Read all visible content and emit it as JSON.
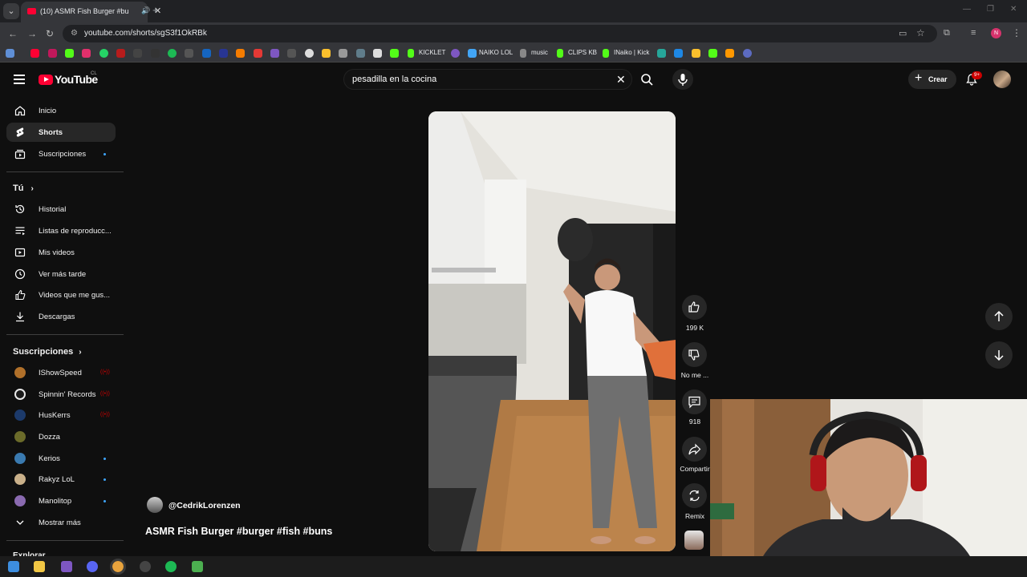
{
  "browser": {
    "tab_title": "(10) ASMR Fish Burger #bu",
    "url": "youtube.com/shorts/sgS3f1OkRBk",
    "bookmarks": [
      "KICKLET",
      "NAIKO LOL",
      "music",
      "CLIPS KB",
      "INaiko | Kick"
    ]
  },
  "header": {
    "logo_text": "YouTube",
    "country": "CL",
    "search_value": "pesadilla en la cocina",
    "create_label": "Crear",
    "notifications_badge": "9+"
  },
  "sidebar": {
    "main": [
      {
        "label": "Inicio",
        "icon": "home-icon"
      },
      {
        "label": "Shorts",
        "icon": "shorts-icon"
      },
      {
        "label": "Suscripciones",
        "icon": "subscriptions-icon"
      }
    ],
    "you_header": "Tú",
    "you": [
      {
        "label": "Historial",
        "icon": "history-icon"
      },
      {
        "label": "Listas de reproducc...",
        "icon": "playlists-icon"
      },
      {
        "label": "Mis videos",
        "icon": "my-videos-icon"
      },
      {
        "label": "Ver más tarde",
        "icon": "watch-later-icon"
      },
      {
        "label": "Videos que me gus...",
        "icon": "liked-icon"
      },
      {
        "label": "Descargas",
        "icon": "downloads-icon"
      }
    ],
    "subs_header": "Suscripciones",
    "subscriptions": [
      {
        "name": "IShowSpeed",
        "status": "live",
        "color": "#b0702a"
      },
      {
        "name": "Spinnin' Records",
        "status": "live",
        "color": "#e8e8e8"
      },
      {
        "name": "HusKerrs",
        "status": "live",
        "color": "#1c3a6b"
      },
      {
        "name": "Dozza",
        "status": "none",
        "color": "#6b6b2a"
      },
      {
        "name": "Kerios",
        "status": "new",
        "color": "#3a7ab0"
      },
      {
        "name": "Rakyz LoL",
        "status": "new",
        "color": "#c9b08a"
      },
      {
        "name": "Manolitop",
        "status": "new",
        "color": "#8a6ab0"
      }
    ],
    "show_more": "Mostrar más",
    "explore_header": "Explorar"
  },
  "short": {
    "channel": "@CedrikLorenzen",
    "title": "ASMR Fish Burger #burger #fish #buns",
    "likes": "199 K",
    "dislike_label": "No me ...",
    "comments": "918",
    "share_label": "Compartir",
    "remix_label": "Remix"
  },
  "colors": {
    "bg": "#0f0f0f",
    "accent": "#ff0033",
    "chip": "#272727"
  }
}
